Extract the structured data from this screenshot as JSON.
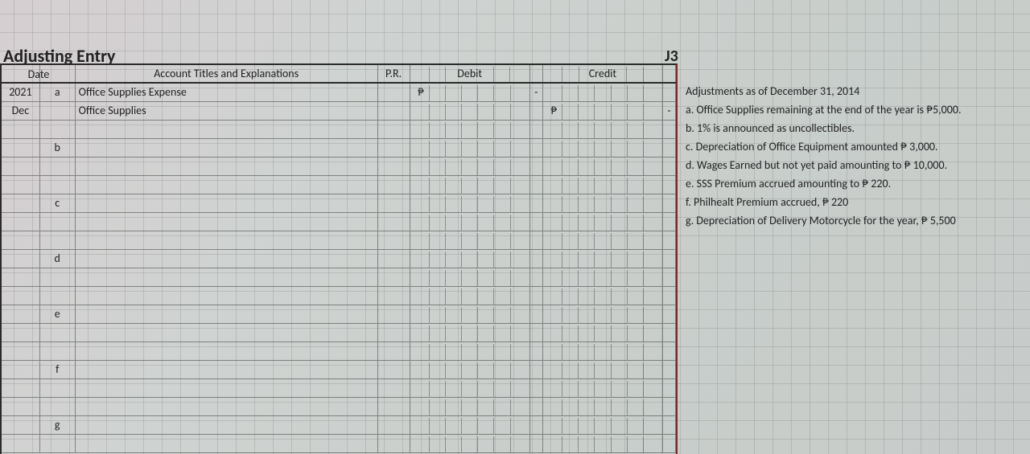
{
  "title": "Adjusting Entry",
  "journal_ref": "J3",
  "headers": {
    "date": "Date",
    "account": "Account Titles and Explanations",
    "pr": "P.R.",
    "debit": "Debit",
    "credit": "Credit"
  },
  "rows": [
    {
      "d1": "2021",
      "d2": "a",
      "acct": "Office Supplies Expense",
      "indent": false,
      "deb_sym": "₱",
      "gap": "-",
      "crd_sym": "",
      "edge": ""
    },
    {
      "d1": "Dec",
      "d2": "",
      "acct": "Office Supplies",
      "indent": true,
      "deb_sym": "",
      "gap": "",
      "crd_sym": "₱",
      "edge": "-"
    },
    {
      "d1": "",
      "d2": "",
      "acct": "",
      "indent": false,
      "deb_sym": "",
      "gap": "",
      "crd_sym": "",
      "edge": ""
    },
    {
      "d1": "",
      "d2": "b",
      "acct": "",
      "indent": false,
      "deb_sym": "",
      "gap": "",
      "crd_sym": "",
      "edge": ""
    },
    {
      "d1": "",
      "d2": "",
      "acct": "",
      "indent": false,
      "deb_sym": "",
      "gap": "",
      "crd_sym": "",
      "edge": ""
    },
    {
      "d1": "",
      "d2": "",
      "acct": "",
      "indent": false,
      "deb_sym": "",
      "gap": "",
      "crd_sym": "",
      "edge": ""
    },
    {
      "d1": "",
      "d2": "c",
      "acct": "",
      "indent": false,
      "deb_sym": "",
      "gap": "",
      "crd_sym": "",
      "edge": ""
    },
    {
      "d1": "",
      "d2": "",
      "acct": "",
      "indent": false,
      "deb_sym": "",
      "gap": "",
      "crd_sym": "",
      "edge": ""
    },
    {
      "d1": "",
      "d2": "",
      "acct": "",
      "indent": false,
      "deb_sym": "",
      "gap": "",
      "crd_sym": "",
      "edge": ""
    },
    {
      "d1": "",
      "d2": "d",
      "acct": "",
      "indent": false,
      "deb_sym": "",
      "gap": "",
      "crd_sym": "",
      "edge": ""
    },
    {
      "d1": "",
      "d2": "",
      "acct": "",
      "indent": false,
      "deb_sym": "",
      "gap": "",
      "crd_sym": "",
      "edge": ""
    },
    {
      "d1": "",
      "d2": "",
      "acct": "",
      "indent": false,
      "deb_sym": "",
      "gap": "",
      "crd_sym": "",
      "edge": ""
    },
    {
      "d1": "",
      "d2": "e",
      "acct": "",
      "indent": false,
      "deb_sym": "",
      "gap": "",
      "crd_sym": "",
      "edge": ""
    },
    {
      "d1": "",
      "d2": "",
      "acct": "",
      "indent": false,
      "deb_sym": "",
      "gap": "",
      "crd_sym": "",
      "edge": ""
    },
    {
      "d1": "",
      "d2": "",
      "acct": "",
      "indent": false,
      "deb_sym": "",
      "gap": "",
      "crd_sym": "",
      "edge": ""
    },
    {
      "d1": "",
      "d2": "f",
      "acct": "",
      "indent": false,
      "deb_sym": "",
      "gap": "",
      "crd_sym": "",
      "edge": ""
    },
    {
      "d1": "",
      "d2": "",
      "acct": "",
      "indent": false,
      "deb_sym": "",
      "gap": "",
      "crd_sym": "",
      "edge": ""
    },
    {
      "d1": "",
      "d2": "",
      "acct": "",
      "indent": false,
      "deb_sym": "",
      "gap": "",
      "crd_sym": "",
      "edge": ""
    },
    {
      "d1": "",
      "d2": "g",
      "acct": "",
      "indent": false,
      "deb_sym": "",
      "gap": "",
      "crd_sym": "",
      "edge": ""
    },
    {
      "d1": "",
      "d2": "",
      "acct": "",
      "indent": false,
      "deb_sym": "",
      "gap": "",
      "crd_sym": "",
      "edge": ""
    }
  ],
  "notes_title": "Adjustments as of December 31, 2014",
  "notes": [
    "a. Office Supplies remaining at the end of the year is ₱5,000.",
    "b. 1% is announced as uncollectibles.",
    "c. Depreciation of Office Equipment amounted ₱ 3,000.",
    "d. Wages Earned but not yet paid amounting to ₱ 10,000.",
    "e. SSS Premium  accrued amounting to ₱ 220.",
    "f. Philhealt Premium accrued, ₱ 220",
    "g. Depreciation of Delivery Motorcycle for the year, ₱  5,500"
  ]
}
